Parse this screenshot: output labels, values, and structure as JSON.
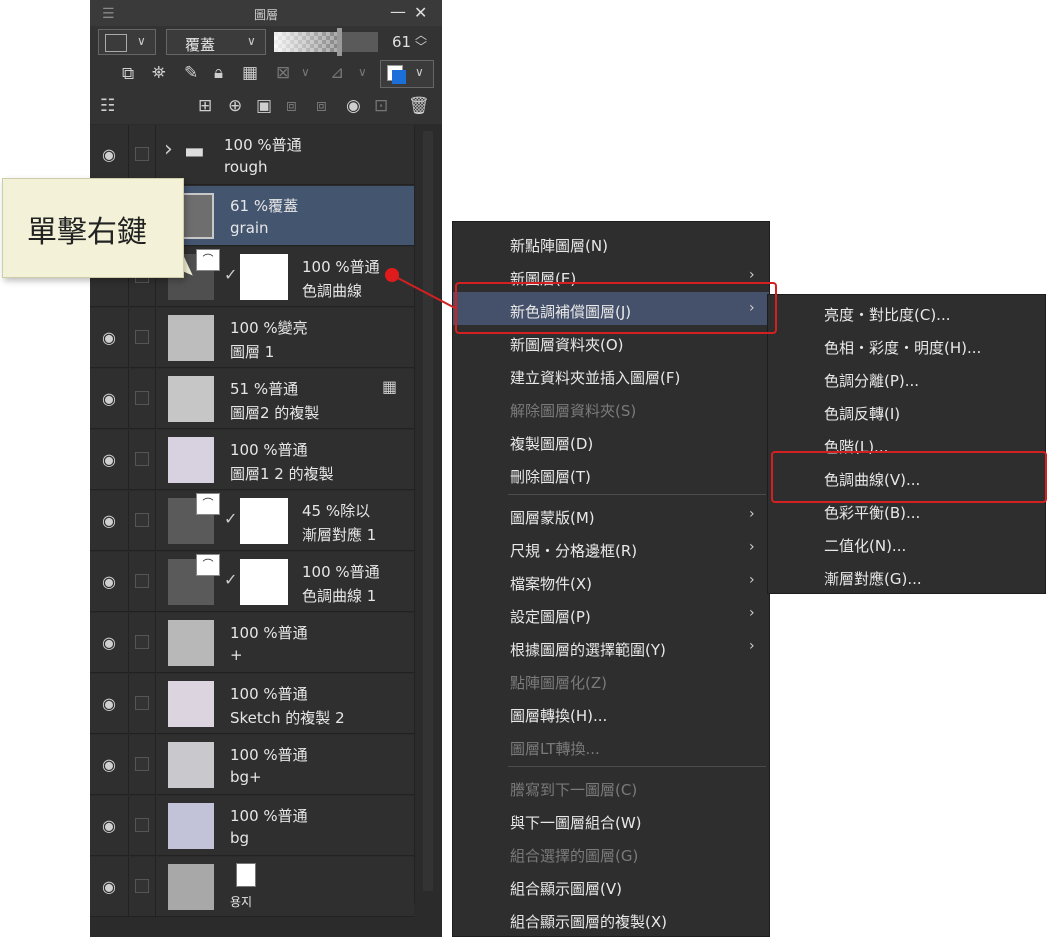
{
  "panel": {
    "title": "圖層",
    "blend_mode": "覆蓋",
    "opacity": 61,
    "opacity_label": "61"
  },
  "layers": [
    {
      "line1": "100 %普通",
      "line2": "rough",
      "type": "folder",
      "selected": false
    },
    {
      "line1": "61 %覆蓋",
      "line2": "grain",
      "type": "raster",
      "selected": true
    },
    {
      "line1": "100 %普通",
      "line2": "色調曲線",
      "type": "correction",
      "selected": false
    },
    {
      "line1": "100 %變亮",
      "line2": "圖層 1",
      "type": "raster",
      "selected": false
    },
    {
      "line1": "51 %普通",
      "line2": "圖層2 的複製",
      "type": "raster",
      "selected": false
    },
    {
      "line1": "100 %普通",
      "line2": "圖層1 2 的複製",
      "type": "raster",
      "selected": false
    },
    {
      "line1": "45 %除以",
      "line2": "漸層對應 1",
      "type": "correction",
      "selected": false
    },
    {
      "line1": "100 %普通",
      "line2": "色調曲線 1",
      "type": "correction",
      "selected": false
    },
    {
      "line1": "100 %普通",
      "line2": "+",
      "type": "raster",
      "selected": false
    },
    {
      "line1": "100 %普通",
      "line2": "Sketch 的複製 2",
      "type": "raster",
      "selected": false
    },
    {
      "line1": "100 %普通",
      "line2": "bg+",
      "type": "raster",
      "selected": false
    },
    {
      "line1": "100 %普通",
      "line2": "bg",
      "type": "raster",
      "selected": false
    },
    {
      "line1": "",
      "line2": "용지",
      "type": "paper",
      "selected": false
    }
  ],
  "callout": {
    "text": "單擊右鍵"
  },
  "context_menu": {
    "items": [
      {
        "label": "新點陣圖層(N)",
        "disabled": false,
        "submenu": false
      },
      {
        "label": "新圖層(E)",
        "disabled": false,
        "submenu": true
      },
      {
        "label": "新色調補償圖層(J)",
        "disabled": false,
        "submenu": true,
        "highlighted": true
      },
      {
        "label": "新圖層資料夾(O)",
        "disabled": false,
        "submenu": false
      },
      {
        "label": "建立資料夾並插入圖層(F)",
        "disabled": false,
        "submenu": false
      },
      {
        "label": "解除圖層資料夾(S)",
        "disabled": true,
        "submenu": false
      },
      {
        "label": "複製圖層(D)",
        "disabled": false,
        "submenu": false
      },
      {
        "label": "刪除圖層(T)",
        "disabled": false,
        "submenu": false
      },
      {
        "label": "圖層蒙版(M)",
        "disabled": false,
        "submenu": true
      },
      {
        "label": "尺規・分格邊框(R)",
        "disabled": false,
        "submenu": true
      },
      {
        "label": "檔案物件(X)",
        "disabled": false,
        "submenu": true
      },
      {
        "label": "設定圖層(P)",
        "disabled": false,
        "submenu": true
      },
      {
        "label": "根據圖層的選擇範圍(Y)",
        "disabled": false,
        "submenu": true
      },
      {
        "label": "點陣圖層化(Z)",
        "disabled": true,
        "submenu": false
      },
      {
        "label": "圖層轉換(H)...",
        "disabled": false,
        "submenu": false
      },
      {
        "label": "圖層LT轉換...",
        "disabled": true,
        "submenu": false
      },
      {
        "label": "謄寫到下一圖層(C)",
        "disabled": true,
        "submenu": false
      },
      {
        "label": "與下一圖層組合(W)",
        "disabled": false,
        "submenu": false
      },
      {
        "label": "組合選擇的圖層(G)",
        "disabled": true,
        "submenu": false
      },
      {
        "label": "組合顯示圖層(V)",
        "disabled": false,
        "submenu": false
      },
      {
        "label": "組合顯示圖層的複製(X)",
        "disabled": false,
        "submenu": false
      }
    ]
  },
  "submenu": {
    "items": [
      {
        "label": "亮度・對比度(C)..."
      },
      {
        "label": "色相・彩度・明度(H)..."
      },
      {
        "label": "色調分離(P)..."
      },
      {
        "label": "色調反轉(I)"
      },
      {
        "label": "色階(L)..."
      },
      {
        "label": "色調曲線(V)...",
        "highlighted": true
      },
      {
        "label": "色彩平衡(B)..."
      },
      {
        "label": "二值化(N)..."
      },
      {
        "label": "漸層對應(G)..."
      }
    ]
  },
  "colors": {
    "panel_bg": "#2b2b2b",
    "selected_row": "#445570",
    "highlight_red": "#d32020",
    "menu_bg": "#2e2e2e"
  }
}
